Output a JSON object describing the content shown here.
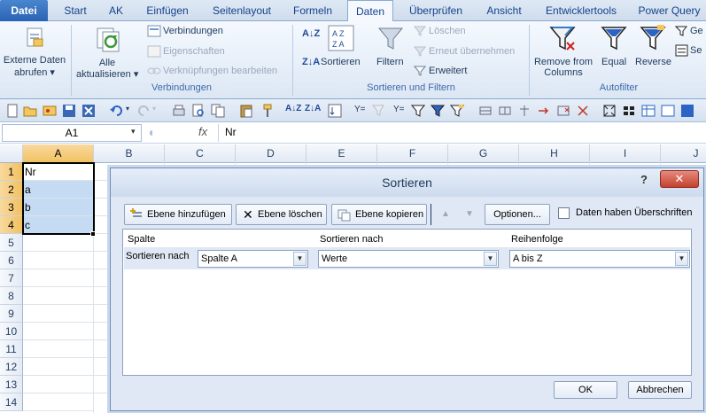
{
  "tabs": [
    "Datei",
    "Start",
    "AK",
    "Einfügen",
    "Seitenlayout",
    "Formeln",
    "Daten",
    "Überprüfen",
    "Ansicht",
    "Entwicklertools",
    "Power Query"
  ],
  "active_tab": "Daten",
  "ribbon": {
    "externe_daten": "Externe Daten",
    "externe_daten2": "abrufen",
    "alle": "Alle",
    "aktualisieren": "aktualisieren",
    "verbindungen": "Verbindungen",
    "eigenschaften": "Eigenschaften",
    "verknuepfungen": "Verknüpfungen bearbeiten",
    "group_verbindungen": "Verbindungen",
    "sortieren": "Sortieren",
    "filtern": "Filtern",
    "loeschen": "Löschen",
    "erneut": "Erneut übernehmen",
    "erweitert": "Erweitert",
    "group_sortieren": "Sortieren und Filtern",
    "remove1": "Remove from",
    "remove2": "Columns",
    "equal": "Equal",
    "reverse": "Reverse",
    "group_autofilter": "Autofilter",
    "cut1": "Ge",
    "cut2": "Se"
  },
  "formula_bar": {
    "name_box": "A1",
    "fx": "fx",
    "value": "Nr"
  },
  "columns": [
    "A",
    "B",
    "C",
    "D",
    "E",
    "F",
    "G",
    "H",
    "I",
    "J"
  ],
  "rows": [
    "1",
    "2",
    "3",
    "4",
    "5",
    "6",
    "7",
    "8",
    "9",
    "10",
    "11",
    "12",
    "13",
    "14"
  ],
  "cells_a": [
    "Nr",
    "a",
    "b",
    "c"
  ],
  "dialog": {
    "title": "Sortieren",
    "help": "?",
    "close": "✕",
    "add_level": "Ebene hinzufügen",
    "delete_level": "Ebene löschen",
    "copy_level": "Ebene kopieren",
    "options": "Optionen...",
    "headers_checkbox": "Daten haben Überschriften",
    "col_spalte": "Spalte",
    "col_sortieren_nach": "Sortieren nach",
    "col_reihenfolge": "Reihenfolge",
    "row_label": "Sortieren nach",
    "spalte_value": "Spalte A",
    "sortieren_value": "Werte",
    "reihenfolge_value": "A bis Z",
    "ok": "OK",
    "cancel": "Abbrechen"
  }
}
